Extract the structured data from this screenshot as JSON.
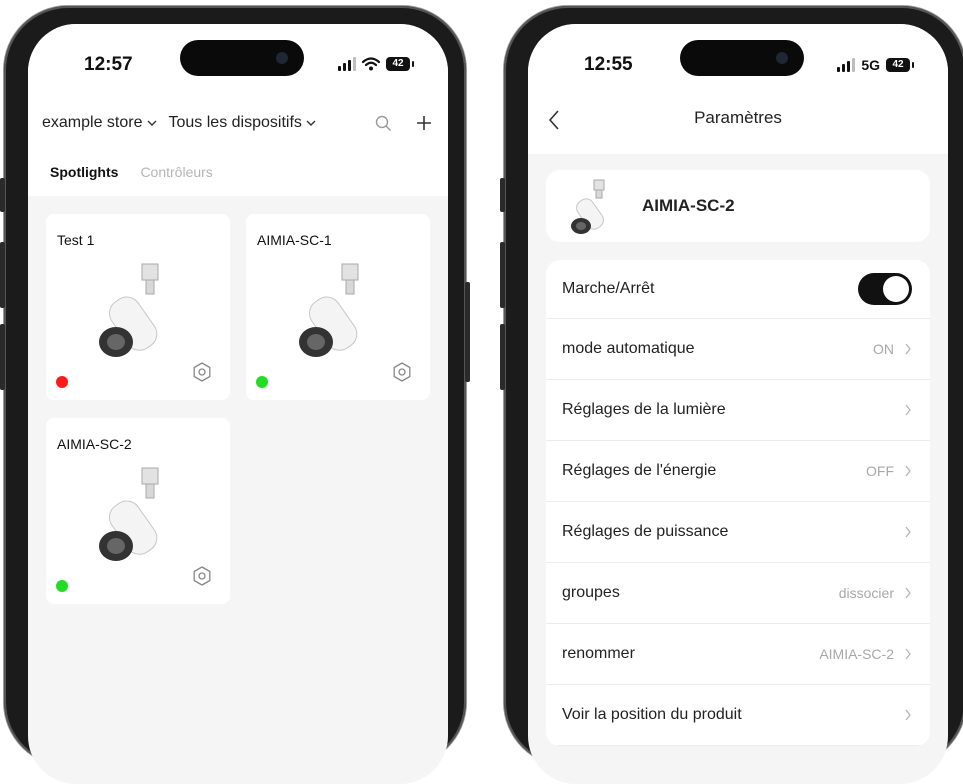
{
  "left_phone": {
    "status": {
      "time": "12:57",
      "battery": "42"
    },
    "header": {
      "store": "example store",
      "device_filter": "Tous les dispositifs"
    },
    "tabs": [
      {
        "label": "Spotlights",
        "active": true
      },
      {
        "label": "Contrôleurs",
        "active": false
      }
    ],
    "devices": [
      {
        "name": "Test 1",
        "status": "offline",
        "status_color": "#ff1a1a"
      },
      {
        "name": "AIMIA-SC-1",
        "status": "online",
        "status_color": "#22dd22"
      },
      {
        "name": "AIMIA-SC-2",
        "status": "online",
        "status_color": "#22dd22"
      }
    ],
    "icons": {
      "search": "search-icon",
      "add": "plus-icon",
      "settings": "gear-icon"
    }
  },
  "right_phone": {
    "status": {
      "time": "12:55",
      "network": "5G",
      "battery": "42"
    },
    "nav": {
      "title": "Paramètres",
      "back_icon": "chevron-left-icon"
    },
    "device": {
      "name": "AIMIA-SC-2"
    },
    "power": {
      "label": "Marche/Arrêt",
      "on": true
    },
    "rows": [
      {
        "label": "mode automatique",
        "value": "ON"
      },
      {
        "label": "Réglages de la lumière",
        "value": ""
      },
      {
        "label": "Réglages de l'énergie",
        "value": "OFF"
      },
      {
        "label": "Réglages de puissance",
        "value": ""
      },
      {
        "label": "groupes",
        "value": "dissocier"
      },
      {
        "label": "renommer",
        "value": "AIMIA-SC-2"
      },
      {
        "label": "Voir la position du produit",
        "value": ""
      }
    ]
  }
}
